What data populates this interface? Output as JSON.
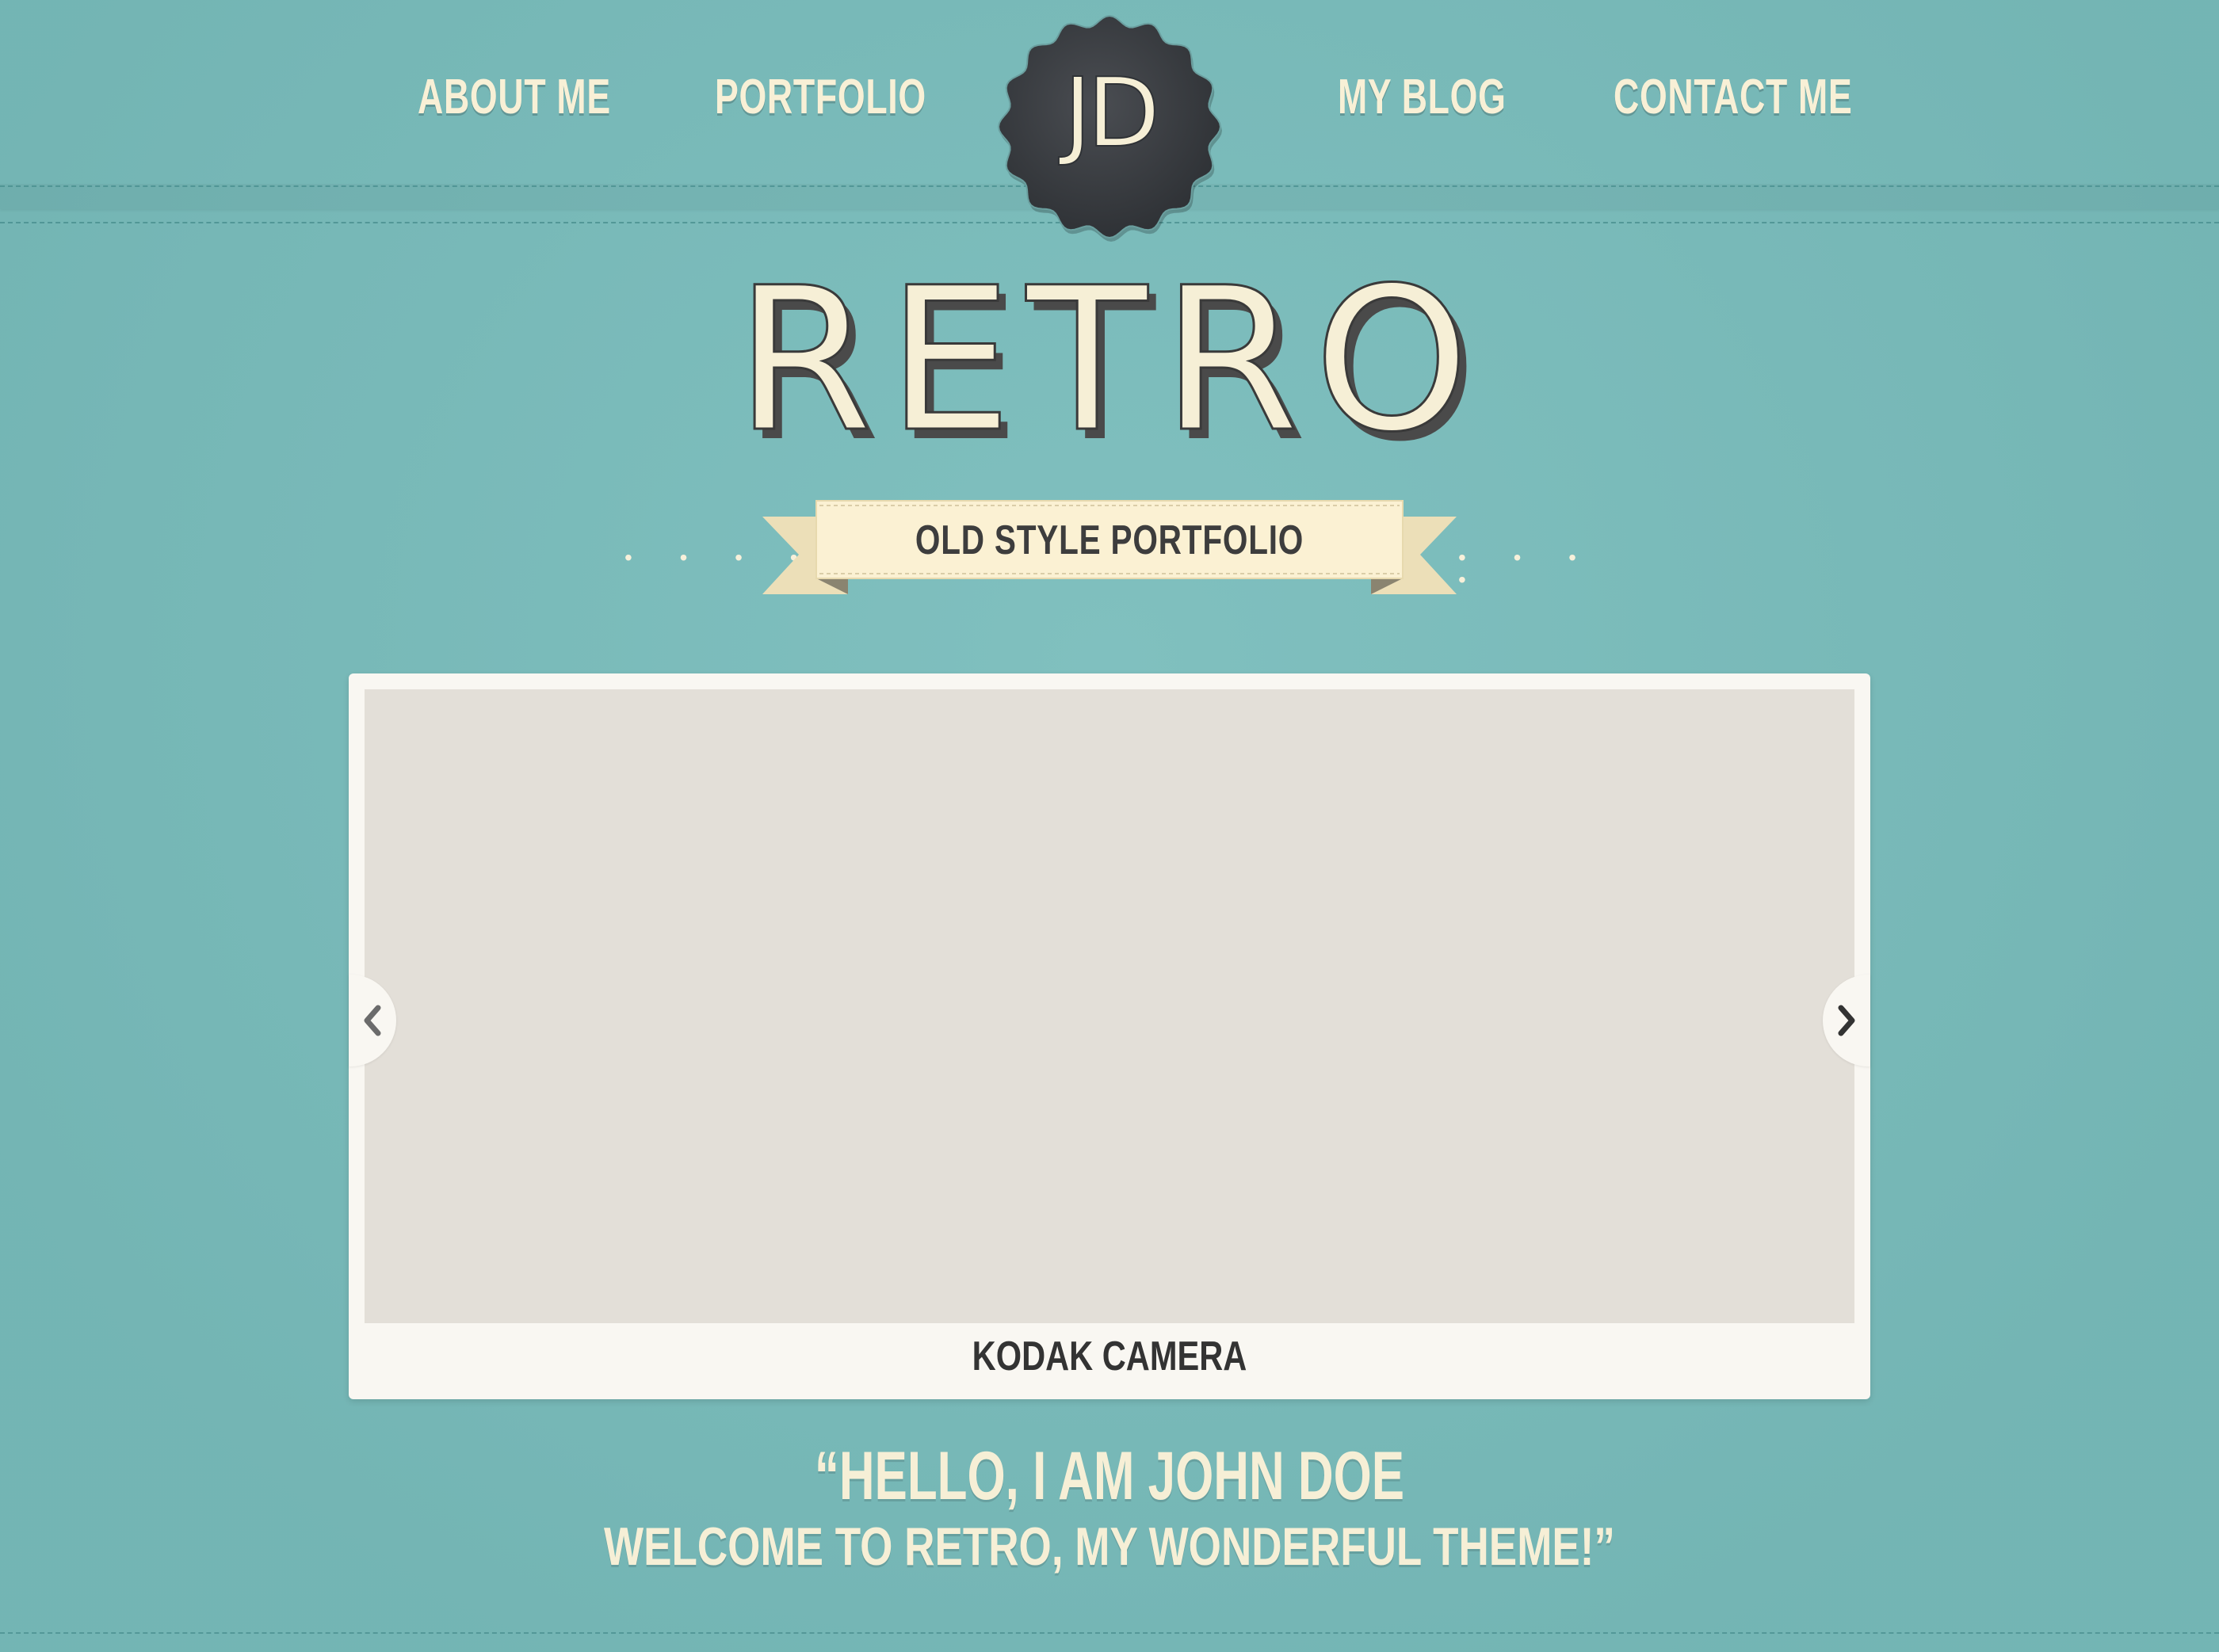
{
  "nav": {
    "items": [
      {
        "label": "ABOUT ME"
      },
      {
        "label": "PORTFOLIO"
      },
      {
        "label": "MY BLOG"
      },
      {
        "label": "CONTACT ME"
      }
    ],
    "logo_text": "JD"
  },
  "hero": {
    "title": "RETRO",
    "ribbon_label": "OLD STYLE PORTFOLIO"
  },
  "slider": {
    "caption": "KODAK CAMERA",
    "prev_icon": "chevron-left-icon",
    "next_icon": "chevron-right-icon"
  },
  "greeting": {
    "line1": "“HELLO, I AM JOHN DOE",
    "line2": "WELCOME TO RETRO, MY WONDERFUL THEME!”"
  },
  "colors": {
    "background": "#78bcbb",
    "cream": "#f6efd6",
    "dark": "#3d3d3d",
    "slide_placeholder": "#e3dfd8",
    "ribbon": "#fbf1d3"
  }
}
